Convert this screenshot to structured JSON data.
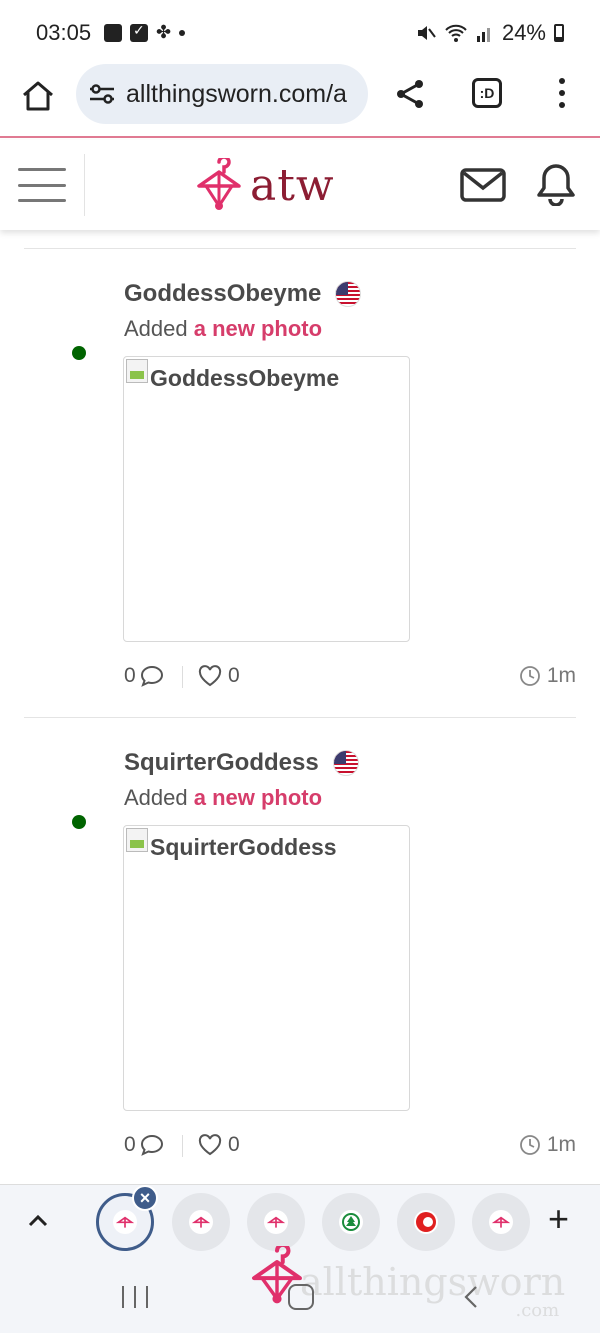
{
  "status_bar": {
    "time": "03:05",
    "battery": "24%",
    "notification_icons": [
      "gallery-icon",
      "checkbox-icon",
      "fan-icon",
      "dot-icon"
    ],
    "system_icons": [
      "mute-icon",
      "wifi-icon",
      "signal-icon",
      "battery-icon"
    ]
  },
  "browser": {
    "url": "allthingsworn.com/a",
    "tabs_label": ":D"
  },
  "site": {
    "logo_text": "atw",
    "brand_color": "#8c1d33",
    "accent_color": "#d63d6b"
  },
  "feed": {
    "items": [
      {
        "username": "GoddessObeyme",
        "action_prefix": "Added",
        "action_link": "a new photo",
        "photo_alt": "GoddessObeyme",
        "comments": "0",
        "likes": "0",
        "time": "1m",
        "online": true,
        "flag": "us-flag"
      },
      {
        "username": "SquirterGoddess",
        "action_prefix": "Added",
        "action_link": "a new photo",
        "photo_alt": "SquirterGoddess",
        "comments": "0",
        "likes": "0",
        "time": "1m",
        "online": true,
        "flag": "us-flag"
      }
    ]
  },
  "tab_strip": {
    "tabs": [
      "atw-tab",
      "atw-tab",
      "atw-tab",
      "tree-tab",
      "red-circle-tab",
      "atw-tab"
    ],
    "new_tab_label": "+"
  },
  "watermark": {
    "text": "allthingsworn",
    "suffix": ".com"
  }
}
